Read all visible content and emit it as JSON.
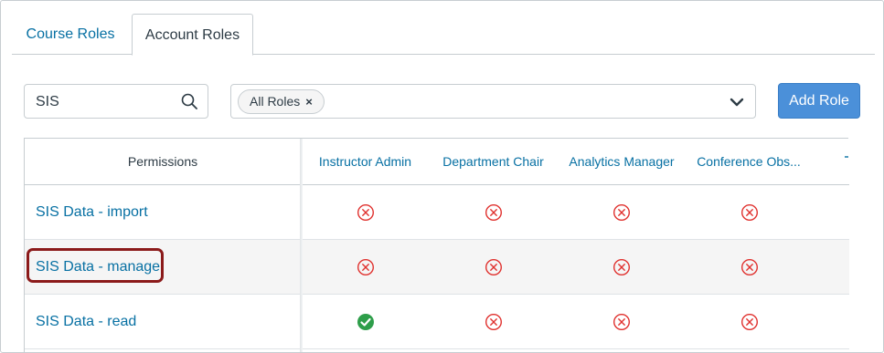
{
  "tabs": [
    {
      "label": "Course Roles",
      "active": false
    },
    {
      "label": "Account Roles",
      "active": true
    }
  ],
  "search": {
    "value": "SIS",
    "icon": "search-icon"
  },
  "filter": {
    "chip_label": "All Roles",
    "chip_remove": "×",
    "icon": "chevron-down-icon"
  },
  "add_role_label": "Add Role",
  "table": {
    "permissions_header": "Permissions",
    "roles": [
      "Instructor Admin",
      "Department Chair",
      "Analytics Manager",
      "Conference Obs..."
    ],
    "rows": [
      {
        "permission": "SIS Data - import",
        "states": [
          "disabled",
          "disabled",
          "disabled",
          "disabled"
        ]
      },
      {
        "permission": "SIS Data - manage",
        "states": [
          "disabled",
          "disabled",
          "disabled",
          "disabled"
        ],
        "highlighted": true
      },
      {
        "permission": "SIS Data - read",
        "states": [
          "enabled",
          "disabled",
          "disabled",
          "disabled"
        ]
      }
    ]
  },
  "colors": {
    "link": "#0770a3",
    "disabled": "#e0312e",
    "enabled": "#2e9e4a",
    "button": "#4b90d9",
    "highlight": "#8b1a1a"
  }
}
